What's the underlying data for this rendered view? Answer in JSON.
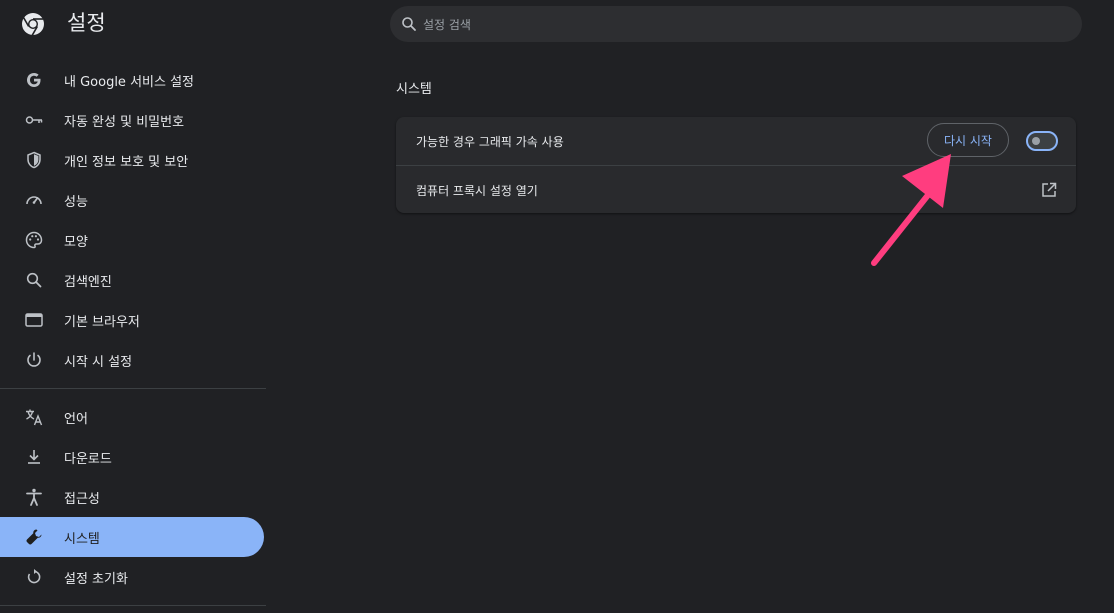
{
  "app": {
    "title": "설정"
  },
  "search": {
    "placeholder": "설정 검색"
  },
  "sidebar": {
    "items": [
      {
        "label": "내 Google 서비스 설정",
        "icon": "google-icon"
      },
      {
        "label": "자동 완성 및 비밀번호",
        "icon": "key-icon"
      },
      {
        "label": "개인 정보 보호 및 보안",
        "icon": "shield-icon"
      },
      {
        "label": "성능",
        "icon": "speedometer-icon"
      },
      {
        "label": "모양",
        "icon": "palette-icon"
      },
      {
        "label": "검색엔진",
        "icon": "search-icon"
      },
      {
        "label": "기본 브라우저",
        "icon": "browser-window-icon"
      },
      {
        "label": "시작 시 설정",
        "icon": "power-icon"
      },
      {
        "label": "언어",
        "icon": "translate-icon"
      },
      {
        "label": "다운로드",
        "icon": "download-icon"
      },
      {
        "label": "접근성",
        "icon": "accessibility-icon"
      },
      {
        "label": "시스템",
        "icon": "wrench-icon",
        "active": true
      },
      {
        "label": "설정 초기화",
        "icon": "reset-icon"
      }
    ]
  },
  "main": {
    "section_title": "시스템",
    "rows": {
      "hardware_acceleration": {
        "label": "가능한 경우 그래픽 가속 사용",
        "restart_label": "다시 시작",
        "toggle_on": false
      },
      "proxy": {
        "label": "컴퓨터 프록시 설정 열기",
        "icon": "external-link-icon"
      }
    }
  },
  "colors": {
    "background": "#202124",
    "card": "#292a2d",
    "accent": "#8ab4f8",
    "annotation_arrow": "#ff3d7f"
  }
}
